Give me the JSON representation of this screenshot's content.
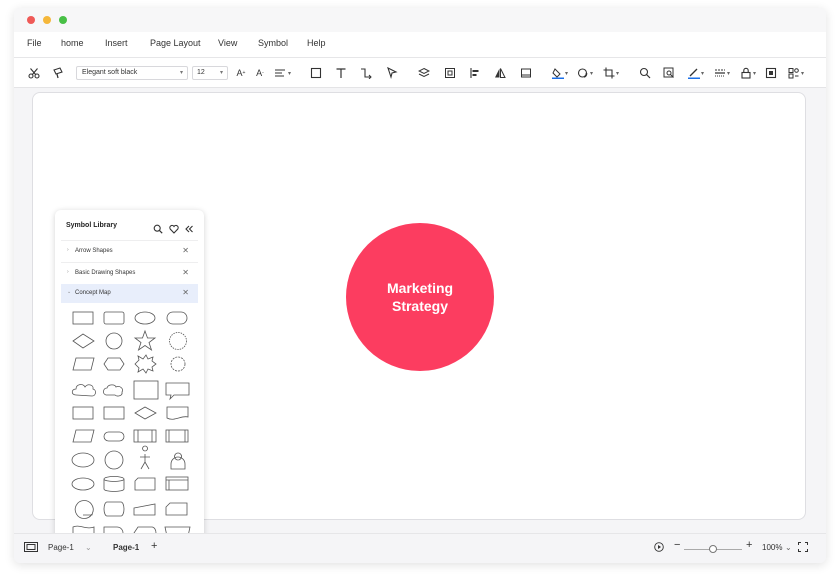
{
  "menu": {
    "items": [
      "File",
      "home",
      "Insert",
      "Page Layout",
      "View",
      "Symbol",
      "Help"
    ]
  },
  "toolbar": {
    "font_family": "Elegant soft black",
    "font_size": "12",
    "icons": [
      "scissors-icon",
      "format-painter-icon",
      "increase-font-icon",
      "decrease-font-icon",
      "align-icon",
      "rectangle-icon",
      "text-icon",
      "connector-icon",
      "pointer-icon",
      "layers-icon",
      "group-icon",
      "align-left-icon",
      "flip-icon",
      "frame-icon",
      "fill-icon",
      "shadow-icon",
      "crop-icon",
      "search-icon",
      "zoom-region-icon",
      "line-color-icon",
      "line-style-icon",
      "lock-icon",
      "fit-icon",
      "more-icon"
    ]
  },
  "canvas": {
    "circle_text_line1": "Marketing",
    "circle_text_line2": "Strategy",
    "circle_color": "#fc3d60"
  },
  "library": {
    "title": "Symbol Library",
    "categories": [
      {
        "label": "Arrow Shapes",
        "active": false
      },
      {
        "label": "Basic Drawing Shapes",
        "active": false
      },
      {
        "label": "Concept Map",
        "active": true
      }
    ]
  },
  "status": {
    "page_selector": "Page-1",
    "page_tab": "Page-1",
    "zoom": "100%",
    "zoom_value": 0.5
  }
}
